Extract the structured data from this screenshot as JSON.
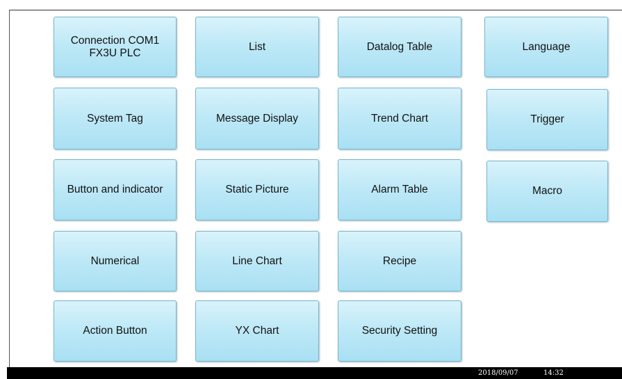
{
  "buttons": {
    "connection_com1": "Connection COM1\nFX3U PLC",
    "list": "List",
    "datalog_table": "Datalog Table",
    "language": "Language",
    "system_tag": "System Tag",
    "message_display": "Message Display",
    "trend_chart": "Trend Chart",
    "trigger": "Trigger",
    "button_and_indicator": "Button and indicator",
    "static_picture": "Static Picture",
    "alarm_table": "Alarm Table",
    "macro": "Macro",
    "numerical": "Numerical",
    "line_chart": "Line Chart",
    "recipe": "Recipe",
    "action_button": "Action Button",
    "yx_chart": "YX Chart",
    "security_setting": "Security Setting"
  },
  "status_bar": {
    "date": "2018/09/07",
    "time": "14:32"
  },
  "colors": {
    "button_top": "#d9f3fb",
    "button_bottom": "#a9e0f3",
    "button_border": "#7ab5cc",
    "status_bar": "#000000"
  }
}
